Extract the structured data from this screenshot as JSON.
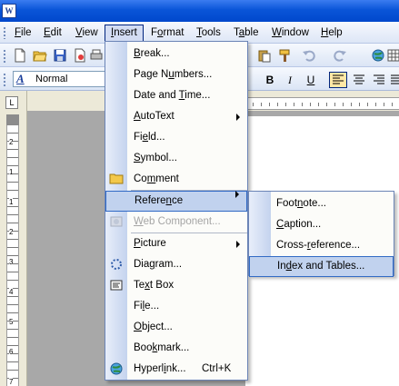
{
  "app": {
    "icon_text": "W"
  },
  "menubar": {
    "items": [
      {
        "pre": "",
        "key": "F",
        "post": "ile"
      },
      {
        "pre": "",
        "key": "E",
        "post": "dit"
      },
      {
        "pre": "",
        "key": "V",
        "post": "iew"
      },
      {
        "pre": "",
        "key": "I",
        "post": "nsert"
      },
      {
        "pre": "F",
        "key": "o",
        "post": "rmat"
      },
      {
        "pre": "",
        "key": "T",
        "post": "ools"
      },
      {
        "pre": "T",
        "key": "a",
        "post": "ble"
      },
      {
        "pre": "",
        "key": "W",
        "post": "indow"
      },
      {
        "pre": "",
        "key": "H",
        "post": "elp"
      }
    ]
  },
  "format_toolbar": {
    "style_value": "Normal",
    "style_glyph": "A",
    "bold": "B",
    "italic": "I",
    "underline": "U"
  },
  "ruler": {
    "corner_glyph": "L",
    "vertical_marks": [
      "2",
      "1",
      "1",
      "2",
      "3",
      "4",
      "5",
      "6",
      "7"
    ]
  },
  "insert_menu": {
    "items": [
      {
        "pre": "",
        "key": "B",
        "post": "reak..."
      },
      {
        "pre": "Page N",
        "key": "u",
        "post": "mbers..."
      },
      {
        "pre": "Date and ",
        "key": "T",
        "post": "ime..."
      },
      {
        "pre": "",
        "key": "A",
        "post": "utoText"
      },
      {
        "pre": "Fi",
        "key": "e",
        "post": "ld..."
      },
      {
        "pre": "",
        "key": "S",
        "post": "ymbol..."
      },
      {
        "pre": "Co",
        "key": "m",
        "post": "ment"
      },
      {
        "pre": "Refere",
        "key": "n",
        "post": "ce"
      },
      {
        "pre": "",
        "key": "W",
        "post": "eb Component..."
      },
      {
        "pre": "",
        "key": "P",
        "post": "icture"
      },
      {
        "pre": "Dia",
        "key": "g",
        "post": "ram..."
      },
      {
        "pre": "Te",
        "key": "x",
        "post": "t Box"
      },
      {
        "pre": "Fi",
        "key": "l",
        "post": "e..."
      },
      {
        "pre": "",
        "key": "O",
        "post": "bject..."
      },
      {
        "pre": "Boo",
        "key": "k",
        "post": "mark..."
      },
      {
        "pre": "Hyperl",
        "key": "i",
        "post": "nk..."
      }
    ],
    "hyperlink_shortcut": "Ctrl+K"
  },
  "reference_menu": {
    "items": [
      {
        "pre": "Foot",
        "key": "n",
        "post": "ote..."
      },
      {
        "pre": "",
        "key": "C",
        "post": "aption..."
      },
      {
        "pre": "Cross-",
        "key": "r",
        "post": "eference..."
      },
      {
        "pre": "In",
        "key": "d",
        "post": "ex and Tables..."
      }
    ]
  }
}
